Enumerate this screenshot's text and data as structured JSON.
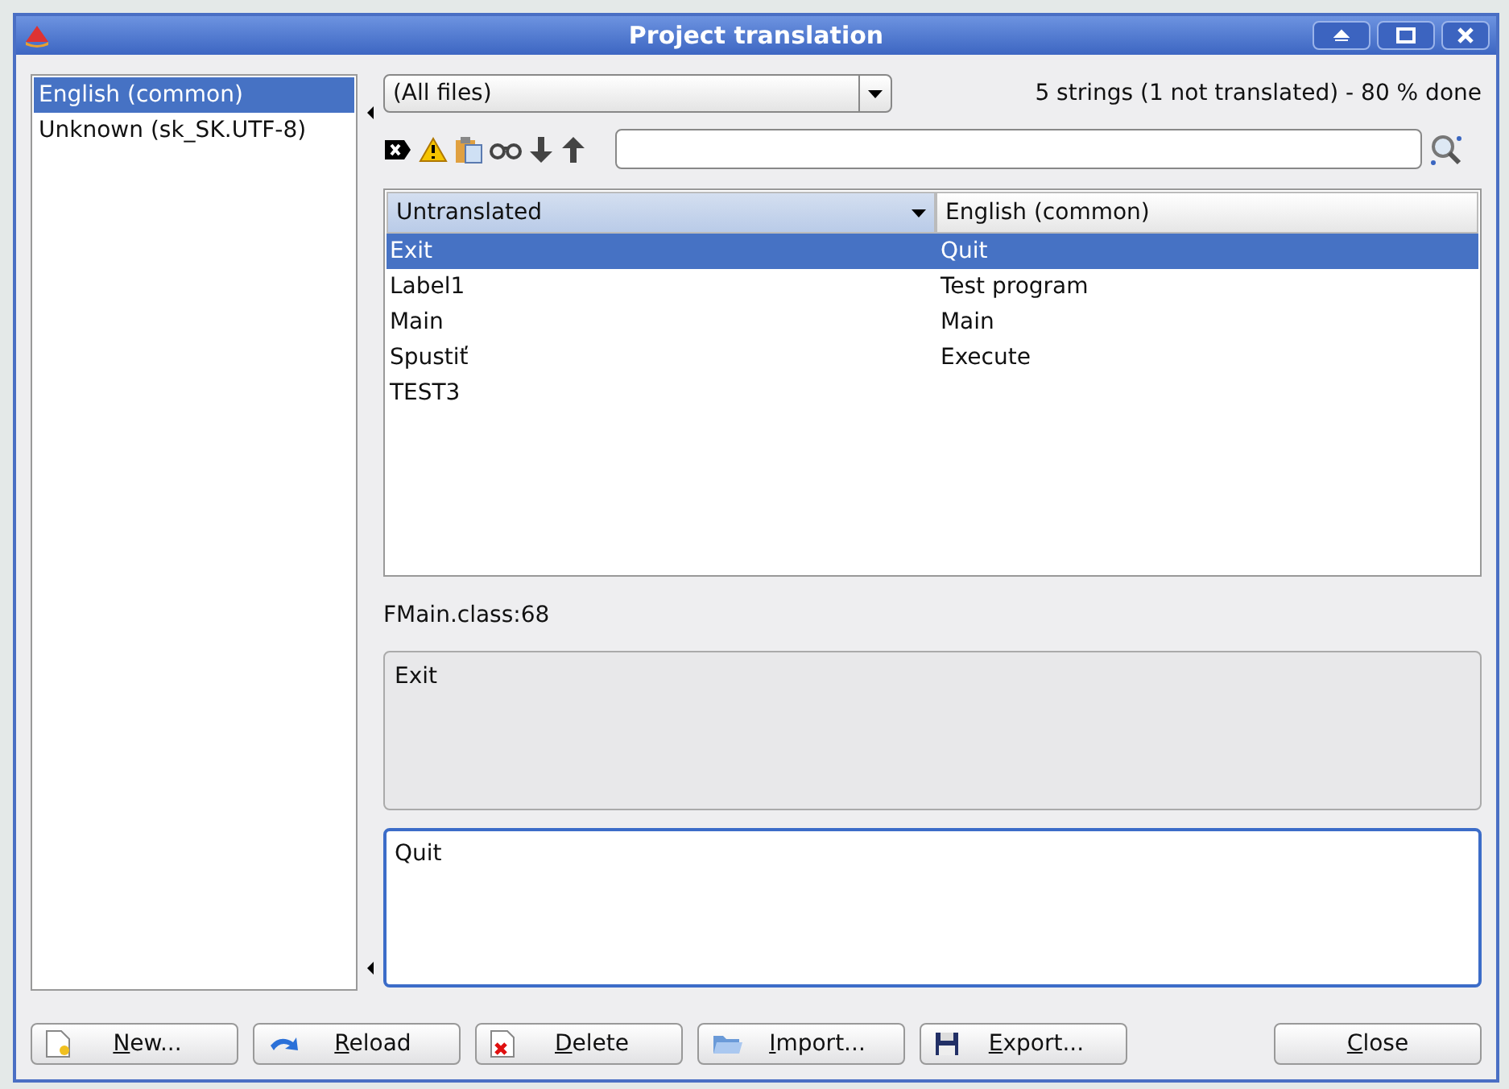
{
  "window": {
    "title": "Project translation"
  },
  "languages": [
    {
      "label": "English (common)",
      "selected": true
    },
    {
      "label": "Unknown (sk_SK.UTF-8)",
      "selected": false
    }
  ],
  "file_filter": {
    "value": "(All files)"
  },
  "summary": "5 strings (1 not translated) - 80 % done",
  "table": {
    "columns": [
      "Untranslated",
      "English (common)"
    ],
    "rows": [
      {
        "cells": [
          "Exit",
          "Quit"
        ],
        "selected": true
      },
      {
        "cells": [
          "Label1",
          "Test program"
        ],
        "selected": false
      },
      {
        "cells": [
          "Main",
          "Main"
        ],
        "selected": false
      },
      {
        "cells": [
          "Spustiť",
          "Execute"
        ],
        "selected": false
      },
      {
        "cells": [
          "TEST3"
        ],
        "selected": false
      }
    ]
  },
  "location": "FMain.class:68",
  "source_text": "Exit",
  "translation_text": "Quit",
  "buttons": [
    {
      "label": "New...",
      "kind": "new"
    },
    {
      "label": "Reload",
      "kind": "reload"
    },
    {
      "label": "Delete",
      "kind": "delete"
    },
    {
      "label": "Import...",
      "kind": "import"
    },
    {
      "label": "Export...",
      "kind": "export"
    },
    {
      "label": "Close",
      "kind": "close"
    }
  ]
}
